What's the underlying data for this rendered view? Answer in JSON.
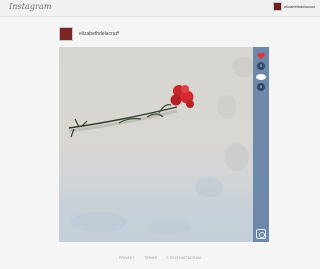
{
  "app": {
    "logo_text": "Instagram"
  },
  "topbar": {
    "username": "elizabethdelacruz"
  },
  "post": {
    "username": "elizabethdelacruz",
    "menu_caret": "▾",
    "like_count": "0",
    "comment_count": "0"
  },
  "footer": {
    "privacy": "PRIVACY",
    "terms": "TERMS",
    "copyright": "© 2013 INSTAGRAM"
  }
}
